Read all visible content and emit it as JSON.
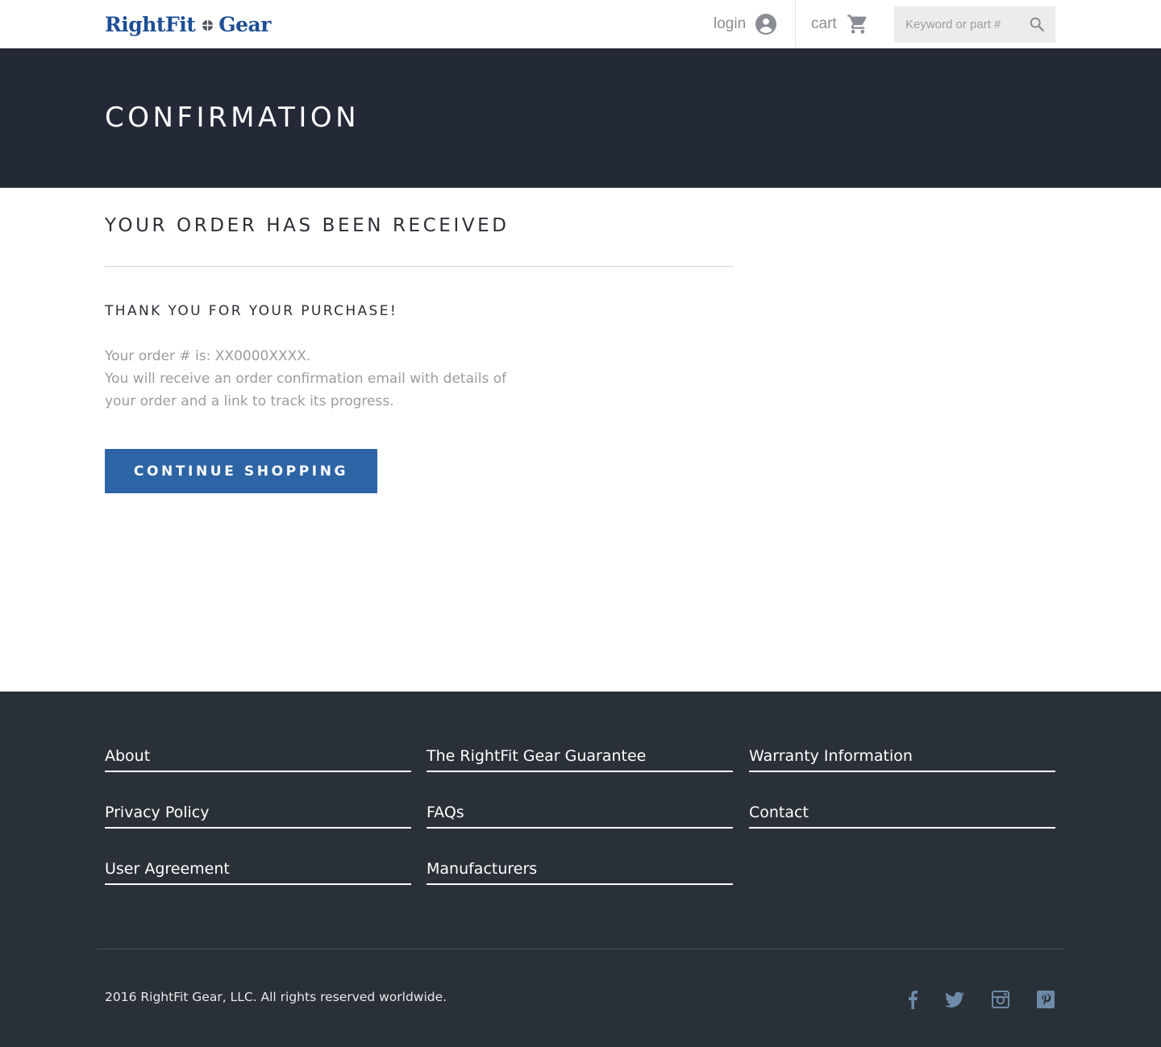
{
  "header": {
    "logo_text_left": "RightFit",
    "logo_text_right": "Gear",
    "login_label": "login",
    "cart_label": "cart",
    "search": {
      "placeholder": "Keyword or part #",
      "value": ""
    }
  },
  "hero": {
    "title": "CONFIRMATION"
  },
  "main": {
    "order_title": "YOUR ORDER HAS BEEN RECEIVED",
    "thanks": "THANK YOU FOR YOUR PURCHASE!",
    "order_number_line": "Your order # is: XX0000XXXX.",
    "email_message": "You will receive an order confirmation email with details of your order and a link to track its progress.",
    "continue_label": "CONTINUE SHOPPING"
  },
  "footer": {
    "links": [
      {
        "label": "About"
      },
      {
        "label": "The RightFit Gear Guarantee"
      },
      {
        "label": "Warranty Information"
      },
      {
        "label": "Privacy Policy"
      },
      {
        "label": "FAQs"
      },
      {
        "label": "Contact"
      },
      {
        "label": "User Agreement"
      },
      {
        "label": "Manufacturers"
      }
    ],
    "copyright": "2016 RightFit Gear, LLC. All rights reserved worldwide.",
    "social_icons": [
      "facebook-icon",
      "twitter-icon",
      "instagram-icon",
      "pinterest-icon"
    ]
  },
  "colors": {
    "brand_blue": "#1e4f96",
    "hero_bg": "#232937",
    "button_bg": "#2d64a5",
    "footer_bg": "#2a3038",
    "social_icon": "#6d8aa8"
  }
}
